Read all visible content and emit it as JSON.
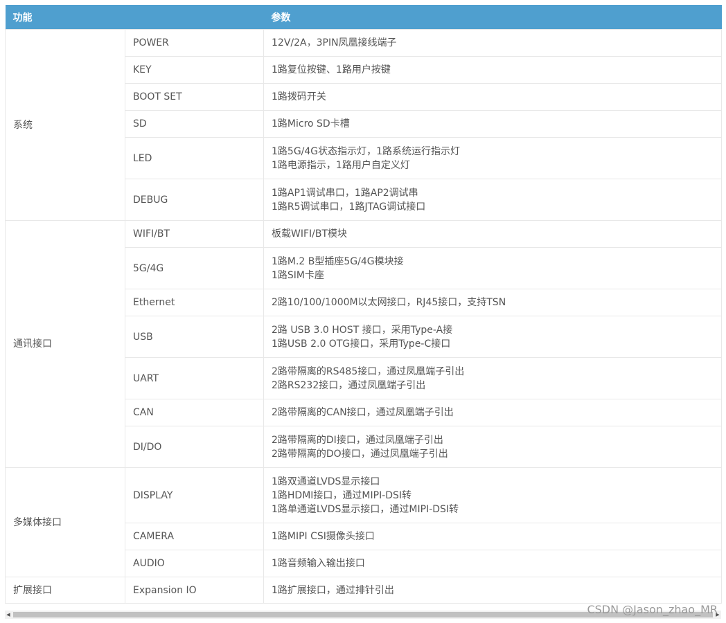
{
  "header": {
    "col1": "功能",
    "col2": "参数"
  },
  "groups": [
    {
      "name": "系统",
      "rows": [
        {
          "label": "POWER",
          "lines": [
            "12V/2A，3PIN凤凰接线端子"
          ]
        },
        {
          "label": "KEY",
          "lines": [
            "1路复位按键、1路用户按键"
          ]
        },
        {
          "label": "BOOT SET",
          "lines": [
            "1路拨码开关"
          ]
        },
        {
          "label": "SD",
          "lines": [
            "1路Micro SD卡槽"
          ]
        },
        {
          "label": "LED",
          "lines": [
            "1路5G/4G状态指示灯，1路系统运行指示灯",
            "1路电源指示，1路用户自定义灯"
          ]
        },
        {
          "label": "DEBUG",
          "lines": [
            "1路AP1调试串口，1路AP2调试串",
            "1路R5调试串口，1路JTAG调试接口"
          ]
        }
      ]
    },
    {
      "name": "通讯接口",
      "rows": [
        {
          "label": "WIFI/BT",
          "lines": [
            "板载WIFI/BT模块"
          ]
        },
        {
          "label": "5G/4G",
          "lines": [
            "1路M.2 B型插座5G/4G模块接",
            "1路SIM卡座"
          ]
        },
        {
          "label": "Ethernet",
          "lines": [
            "2路10/100/1000M以太网接口，RJ45接口，支持TSN"
          ]
        },
        {
          "label": "USB",
          "lines": [
            "2路 USB 3.0 HOST 接口，采用Type-A接",
            "1路USB 2.0 OTG接口，采用Type-C接口"
          ]
        },
        {
          "label": "UART",
          "lines": [
            "2路带隔离的RS485接口，通过凤凰端子引出",
            "2路RS232接口，通过凤凰端子引出"
          ]
        },
        {
          "label": "CAN",
          "lines": [
            "2路带隔离的CAN接口，通过凤凰端子引出"
          ]
        },
        {
          "label": "DI/DO",
          "lines": [
            "2路带隔离的DI接口，通过凤凰端子引出",
            "2路带隔离的DO接口，通过凤凰端子引出"
          ]
        }
      ]
    },
    {
      "name": "多媒体接口",
      "rows": [
        {
          "label": "DISPLAY",
          "lines": [
            "1路双通道LVDS显示接口",
            "1路HDMI接口，通过MIPI-DSI转",
            "1路单通道LVDS显示接口，通过MIPI-DSI转"
          ]
        },
        {
          "label": "CAMERA",
          "lines": [
            "1路MIPI CSI摄像头接口"
          ]
        },
        {
          "label": "AUDIO",
          "lines": [
            "1路音频输入输出接口"
          ]
        }
      ]
    },
    {
      "name": "扩展接口",
      "rows": [
        {
          "label": "Expansion IO",
          "lines": [
            "1路扩展接口，通过排针引出"
          ]
        }
      ]
    }
  ],
  "watermark": "CSDN @Jason_zhao_MR",
  "scrollbar": {
    "left_arrow": "◀",
    "right_arrow": "▶"
  }
}
